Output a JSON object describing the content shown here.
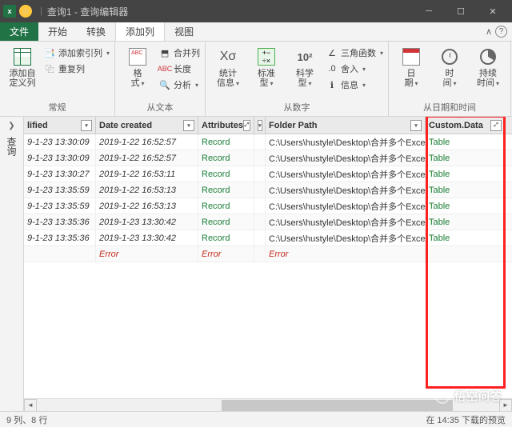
{
  "window": {
    "title": "查询1 - 查询编辑器"
  },
  "tabs": {
    "file": "文件",
    "start": "开始",
    "convert": "转换",
    "addcol": "添加列",
    "view": "视图"
  },
  "ribbon": {
    "group_general": {
      "label": "常规",
      "add_custom_col": "添加自\n定义列",
      "add_index_col": "添加索引列",
      "duplicate_col": "重复列"
    },
    "group_text": {
      "label": "从文本",
      "format": "格\n式",
      "merge_col": "合并列",
      "length": "长度",
      "analyze": "分析"
    },
    "group_number": {
      "label": "从数字",
      "stats": "统计\n信息",
      "standard": "标准\n型",
      "scientific": "科学\n型",
      "trig": "三角函数",
      "rounding": "舍入",
      "info": "信息"
    },
    "group_datetime": {
      "label": "从日期和时间",
      "date": "日\n期",
      "time": "时\n间",
      "duration": "持续\n时间"
    }
  },
  "sidebar": {
    "queries": "查询"
  },
  "columns": {
    "lified": "lified",
    "date_created": "Date created",
    "attributes": "Attributes",
    "folder_path": "Folder Path",
    "custom_data": "Custom.Data"
  },
  "rows": [
    {
      "lified": "9-1-23 13:30:09",
      "created": "2019-1-22 16:52:57",
      "attr": "Record",
      "folder": "C:\\Users\\hustyle\\Desktop\\合并多个Excel文",
      "custom": "Table"
    },
    {
      "lified": "9-1-23 13:30:09",
      "created": "2019-1-22 16:52:57",
      "attr": "Record",
      "folder": "C:\\Users\\hustyle\\Desktop\\合并多个Excel文",
      "custom": "Table"
    },
    {
      "lified": "9-1-23 13:30:27",
      "created": "2019-1-22 16:53:11",
      "attr": "Record",
      "folder": "C:\\Users\\hustyle\\Desktop\\合并多个Excel文",
      "custom": "Table"
    },
    {
      "lified": "9-1-23 13:35:59",
      "created": "2019-1-22 16:53:13",
      "attr": "Record",
      "folder": "C:\\Users\\hustyle\\Desktop\\合并多个Excel文",
      "custom": "Table"
    },
    {
      "lified": "9-1-23 13:35:59",
      "created": "2019-1-22 16:53:13",
      "attr": "Record",
      "folder": "C:\\Users\\hustyle\\Desktop\\合并多个Excel文",
      "custom": "Table"
    },
    {
      "lified": "9-1-23 13:35:36",
      "created": "2019-1-23 13:30:42",
      "attr": "Record",
      "folder": "C:\\Users\\hustyle\\Desktop\\合并多个Excel文",
      "custom": "Table"
    },
    {
      "lified": "9-1-23 13:35:36",
      "created": "2019-1-23 13:30:42",
      "attr": "Record",
      "folder": "C:\\Users\\hustyle\\Desktop\\合并多个Excel文",
      "custom": "Table"
    },
    {
      "lified": "",
      "created": "Error",
      "attr": "Error",
      "folder": "Error",
      "custom": ""
    }
  ],
  "status": {
    "left": "9 列、8 行",
    "right": "在 14:35 下载的预览"
  },
  "watermark": "悟空问答",
  "ten_sq": "10²"
}
